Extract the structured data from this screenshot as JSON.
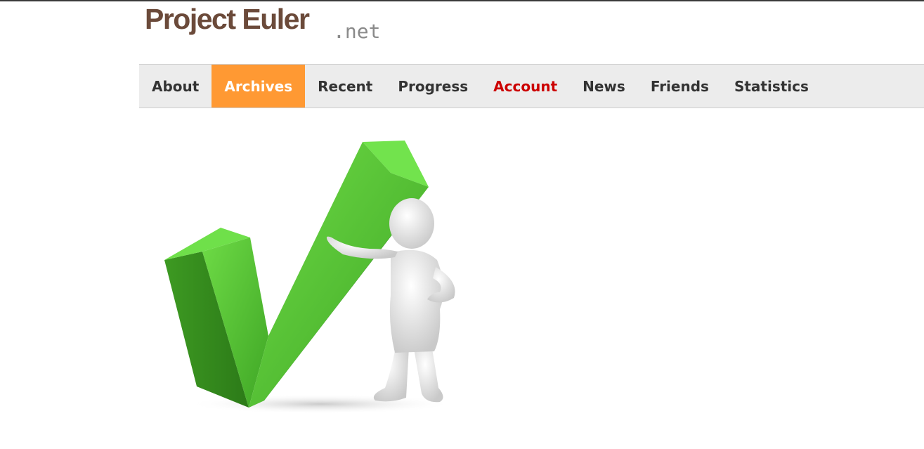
{
  "logo": {
    "main_text": "Project Euler",
    "suffix_text": ".net"
  },
  "nav": {
    "items": [
      {
        "label": "About",
        "state": "normal"
      },
      {
        "label": "Archives",
        "state": "active"
      },
      {
        "label": "Recent",
        "state": "normal"
      },
      {
        "label": "Progress",
        "state": "normal"
      },
      {
        "label": "Account",
        "state": "alert"
      },
      {
        "label": "News",
        "state": "normal"
      },
      {
        "label": "Friends",
        "state": "normal"
      },
      {
        "label": "Statistics",
        "state": "normal"
      }
    ]
  },
  "colors": {
    "active_tab": "#ff9933",
    "alert_text": "#cc0000",
    "nav_background": "#ececec",
    "logo_brown": "#6b4a3a",
    "check_green": "#5cc83a"
  },
  "hero": {
    "icon": "green-checkmark-with-figure-illustration"
  }
}
